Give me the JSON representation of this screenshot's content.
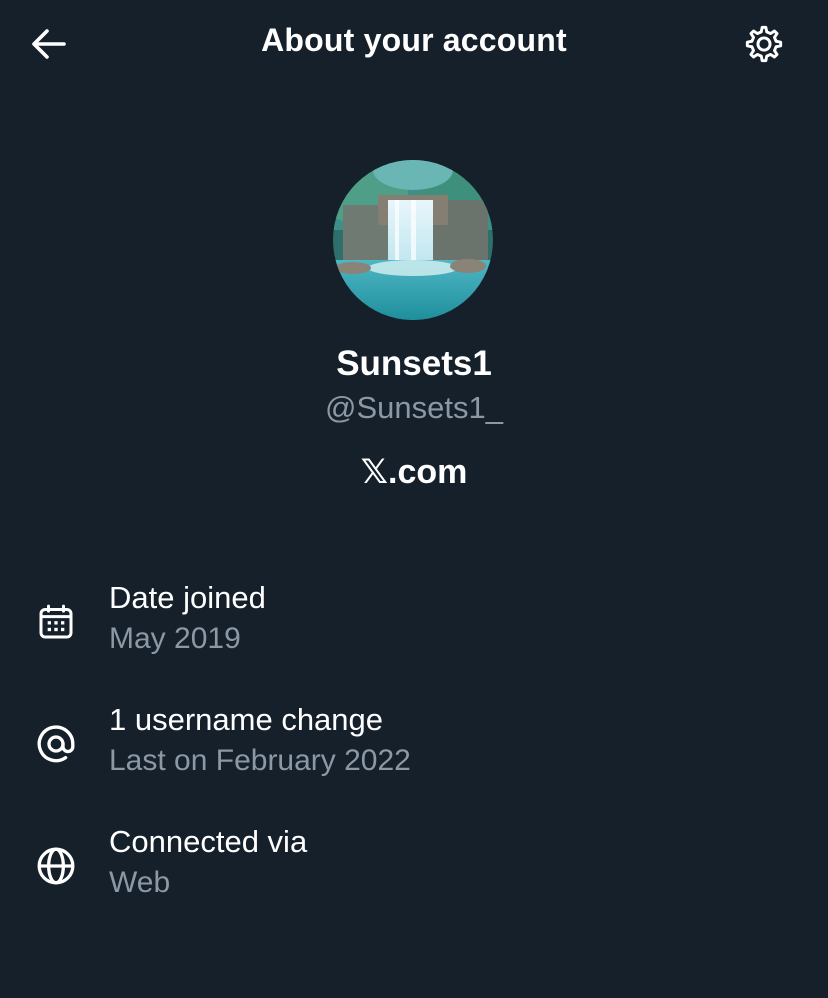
{
  "header": {
    "title": "About your account"
  },
  "profile": {
    "display_name": "Sunsets1",
    "handle": "@Sunsets1_",
    "site": "𝕏.com"
  },
  "details": [
    {
      "title": "Date joined",
      "subtitle": "May 2019",
      "icon": "calendar-icon"
    },
    {
      "title": "1 username change",
      "subtitle": "Last on February 2022",
      "icon": "at-sign-icon"
    },
    {
      "title": "Connected via",
      "subtitle": "Web",
      "icon": "globe-icon"
    }
  ],
  "colors": {
    "background": "#16202b",
    "text_primary": "#ffffff",
    "text_secondary": "#8b98a5"
  }
}
